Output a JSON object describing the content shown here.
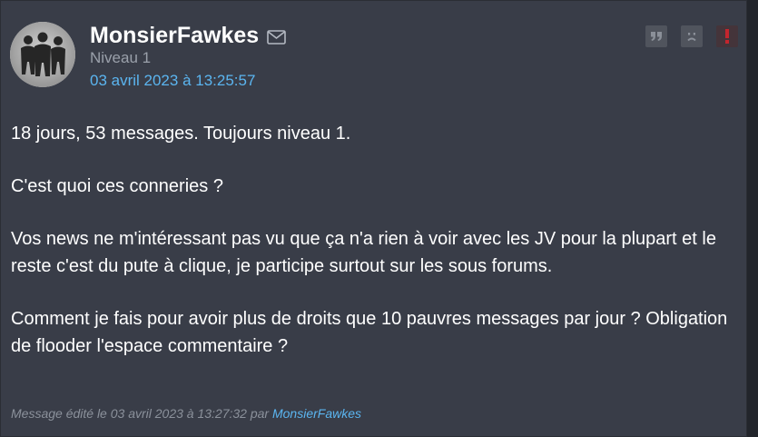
{
  "post": {
    "author": "MonsierFawkes",
    "level": "Niveau 1",
    "date": "03 avril 2023 à 13:25:57",
    "paragraphs": [
      "18 jours, 53 messages. Toujours niveau 1.",
      "C'est quoi ces conneries ?",
      "Vos news ne m'intéressant pas vu que ça n'a rien à voir avec les JV pour la plupart et le reste c'est du pute à clique, je participe surtout sur les sous forums.",
      "Comment je fais pour avoir plus de droits que 10 pauvres messages par jour ? Obligation de flooder l'espace commentaire ?"
    ],
    "edit_note_prefix": "Message édité le 03 avril 2023 à 13:27:32 par ",
    "edit_author": "MonsierFawkes"
  },
  "icons": {
    "mail": "envelope-icon",
    "quote": "quote-icon",
    "sad": "sad-face-icon",
    "report": "exclamation-icon"
  },
  "colors": {
    "background": "#393d48",
    "link": "#5bb5f0",
    "muted": "#9aa0aa",
    "report": "#c4252d"
  }
}
